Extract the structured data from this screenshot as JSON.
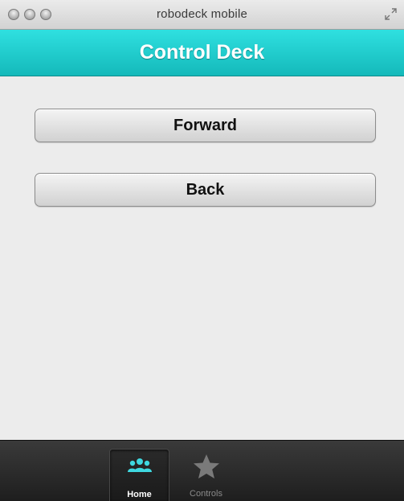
{
  "window": {
    "title": "robodeck mobile"
  },
  "header": {
    "title": "Control Deck"
  },
  "actions": {
    "forward_label": "Forward",
    "back_label": "Back"
  },
  "tabbar": {
    "tabs": [
      {
        "label": "Home",
        "icon": "people-icon",
        "active": true
      },
      {
        "label": "Controls",
        "icon": "star-icon",
        "active": false
      }
    ]
  },
  "colors": {
    "header_accent": "#1fcfd0",
    "active_icon": "#3fd8e0",
    "tabbar_bg": "#2a2a2a"
  }
}
